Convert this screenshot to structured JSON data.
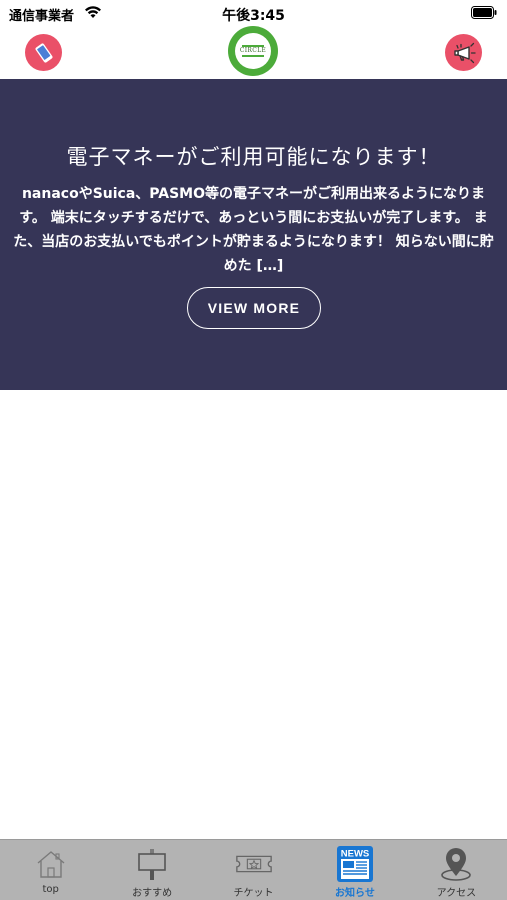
{
  "status_bar": {
    "carrier": "通信事業者",
    "time": "午後3:45"
  },
  "header": {
    "left_icon": "phone-icon",
    "right_icon": "megaphone-icon",
    "logo_text": "CIRCLE",
    "colors": {
      "icon_bg": "#ea5068",
      "logo_ring": "#4cab3a"
    }
  },
  "news": {
    "title": "電子マネーがご利用可能になります！",
    "body": "nanacoやSuica、PASMO等の電子マネーがご利用出来るようになります。 端末にタッチするだけで、あっという間にお支払いが完了します。 また、当店のお支払いでもポイントが貯まるようになります！ 知らない間に貯めた […]",
    "button_label": "VIEW MORE",
    "background": "#363557"
  },
  "tab_bar": {
    "items": [
      {
        "label": "top",
        "icon": "home-icon",
        "active": false
      },
      {
        "label": "おすすめ",
        "icon": "signboard-icon",
        "active": false
      },
      {
        "label": "チケット",
        "icon": "ticket-icon",
        "active": false
      },
      {
        "label": "お知らせ",
        "icon": "news-icon",
        "icon_text": "NEWS",
        "active": true
      },
      {
        "label": "アクセス",
        "icon": "map-pin-icon",
        "active": false
      }
    ],
    "active_color": "#1876d2"
  }
}
